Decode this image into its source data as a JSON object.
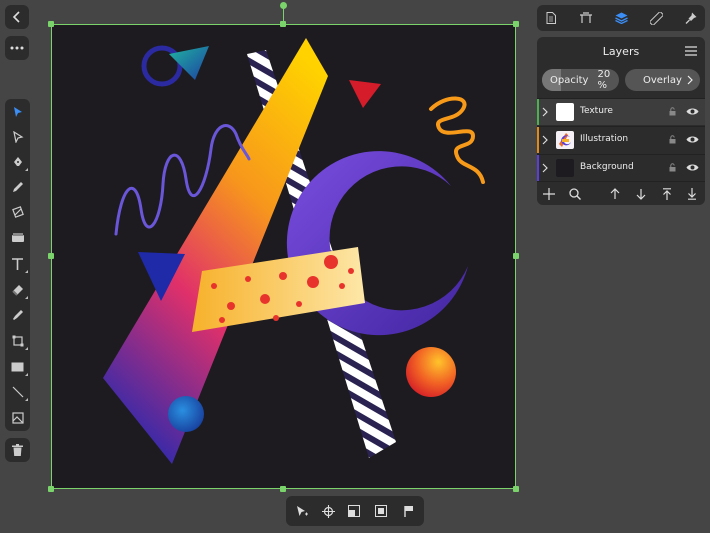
{
  "layers_panel": {
    "title": "Layers",
    "opacity_label": "Opacity",
    "opacity_value": "20 %",
    "opacity_fraction": 0.2,
    "blend_mode": "Overlay",
    "layers": [
      {
        "name": "Texture",
        "color": "#4caf50"
      },
      {
        "name": "Illustration",
        "color": "#e08a1a"
      },
      {
        "name": "Background",
        "color": "#5b3fd6"
      }
    ]
  },
  "colors": {
    "accent": "#3a8ef6",
    "selection": "#7ad36b",
    "panel_bg": "#2c2c2c",
    "app_bg": "#454545",
    "canvas_bg": "#1d1b20"
  },
  "icons": {
    "back": "chevron-left-icon",
    "more": "more-icon",
    "tools": [
      "move-tool-icon",
      "node-tool-icon",
      "pen-tool-icon",
      "pencil-tool-icon",
      "vector-brush-icon",
      "fill-tool-icon",
      "text-tool-icon",
      "eraser-icon",
      "color-picker-icon",
      "crop-tool-icon",
      "rectangle-tool-icon",
      "line-tool-icon",
      "place-image-icon",
      "trash-icon"
    ],
    "studio_tabs": [
      "document-icon",
      "transform-icon",
      "layers-icon",
      "ruler-icon",
      "pin-icon"
    ],
    "panel_footer": [
      "add-layer-icon",
      "search-icon",
      "move-up-icon",
      "move-down-icon",
      "move-to-top-icon",
      "move-to-bottom-icon"
    ],
    "context": [
      "select-icon",
      "pivot-icon",
      "flip-icon",
      "group-icon",
      "pin-icon"
    ]
  }
}
